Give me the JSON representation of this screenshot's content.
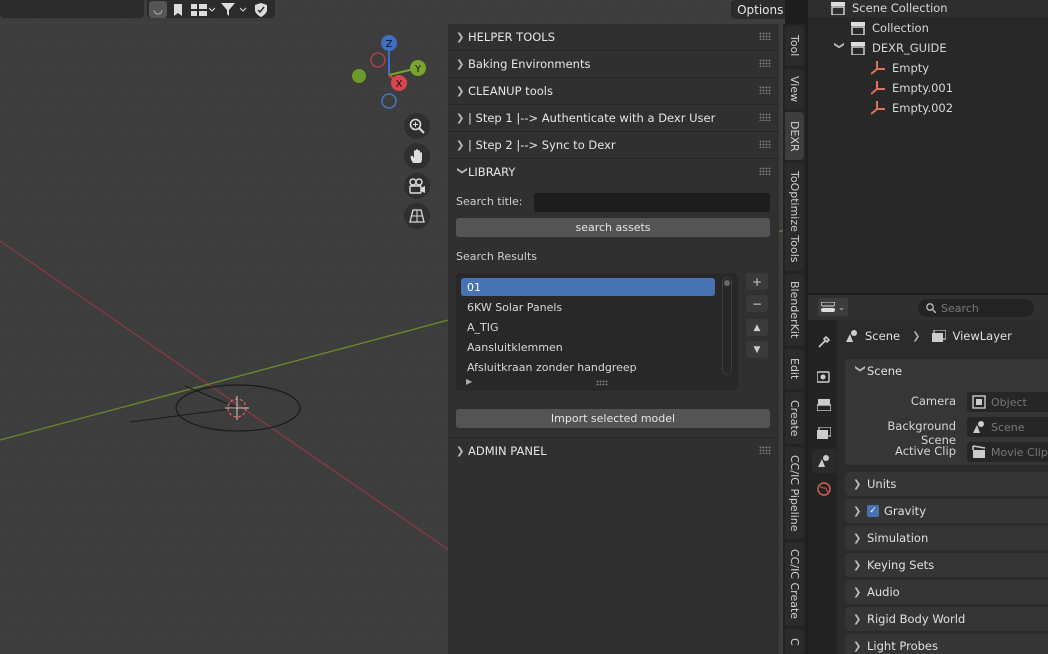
{
  "viewport": {
    "header": {
      "options_label": "Options"
    },
    "gizmo": {
      "z": "Z",
      "y": "Y",
      "x": "X"
    }
  },
  "npanel": {
    "panels": [
      {
        "label": "HELPER TOOLS"
      },
      {
        "label": "Baking Environments"
      },
      {
        "label": "CLEANUP tools"
      },
      {
        "label": "| Step 1 |--> Authenticate with a Dexr User"
      },
      {
        "label": "| Step 2 |--> Sync to Dexr"
      }
    ],
    "library": {
      "label": "LIBRARY",
      "search_title_label": "Search title:",
      "search_title_value": "",
      "search_button": "search assets",
      "results_label": "Search Results",
      "results": [
        "01",
        "6KW Solar Panels",
        "A_TIG",
        "Aansluitklemmen",
        "Afsluitkraan zonder handgreep"
      ],
      "selected_index": 0,
      "add_label": "+",
      "remove_label": "−",
      "up_label": "▲",
      "down_label": "▼",
      "import_button": "Import selected model"
    },
    "admin": {
      "label": "ADMIN PANEL"
    }
  },
  "tabs": [
    "Tool",
    "View",
    "DEXR",
    "ToOptimize Tools",
    "BlenderKit",
    "Edit",
    "Create",
    "CC/IC Pipeline",
    "CC/IC Create",
    "C"
  ],
  "active_tab": "DEXR",
  "outliner": {
    "rows": [
      {
        "label": "Scene Collection",
        "indent": 0,
        "icon": "collection-icon"
      },
      {
        "label": "Collection",
        "indent": 1,
        "icon": "collection-icon"
      },
      {
        "label": "DEXR_GUIDE",
        "indent": 1,
        "icon": "collection-icon",
        "expanded": true
      },
      {
        "label": "Empty",
        "indent": 2,
        "icon": "empty-icon"
      },
      {
        "label": "Empty.001",
        "indent": 2,
        "icon": "empty-icon"
      },
      {
        "label": "Empty.002",
        "indent": 2,
        "icon": "empty-icon"
      }
    ]
  },
  "properties": {
    "search_placeholder": "Search",
    "breadcrumb": {
      "scene": "Scene",
      "viewlayer": "ViewLayer"
    },
    "scene_panel": {
      "label": "Scene",
      "camera_label": "Camera",
      "camera_value": "Object",
      "bg_label": "Background Scene",
      "bg_value": "Scene",
      "clip_label": "Active Clip",
      "clip_value": "Movie Clip"
    },
    "subpanels": [
      "Units",
      "Gravity",
      "Simulation",
      "Keying Sets",
      "Audio",
      "Rigid Body World",
      "Light Probes"
    ],
    "gravity_checked": true
  }
}
